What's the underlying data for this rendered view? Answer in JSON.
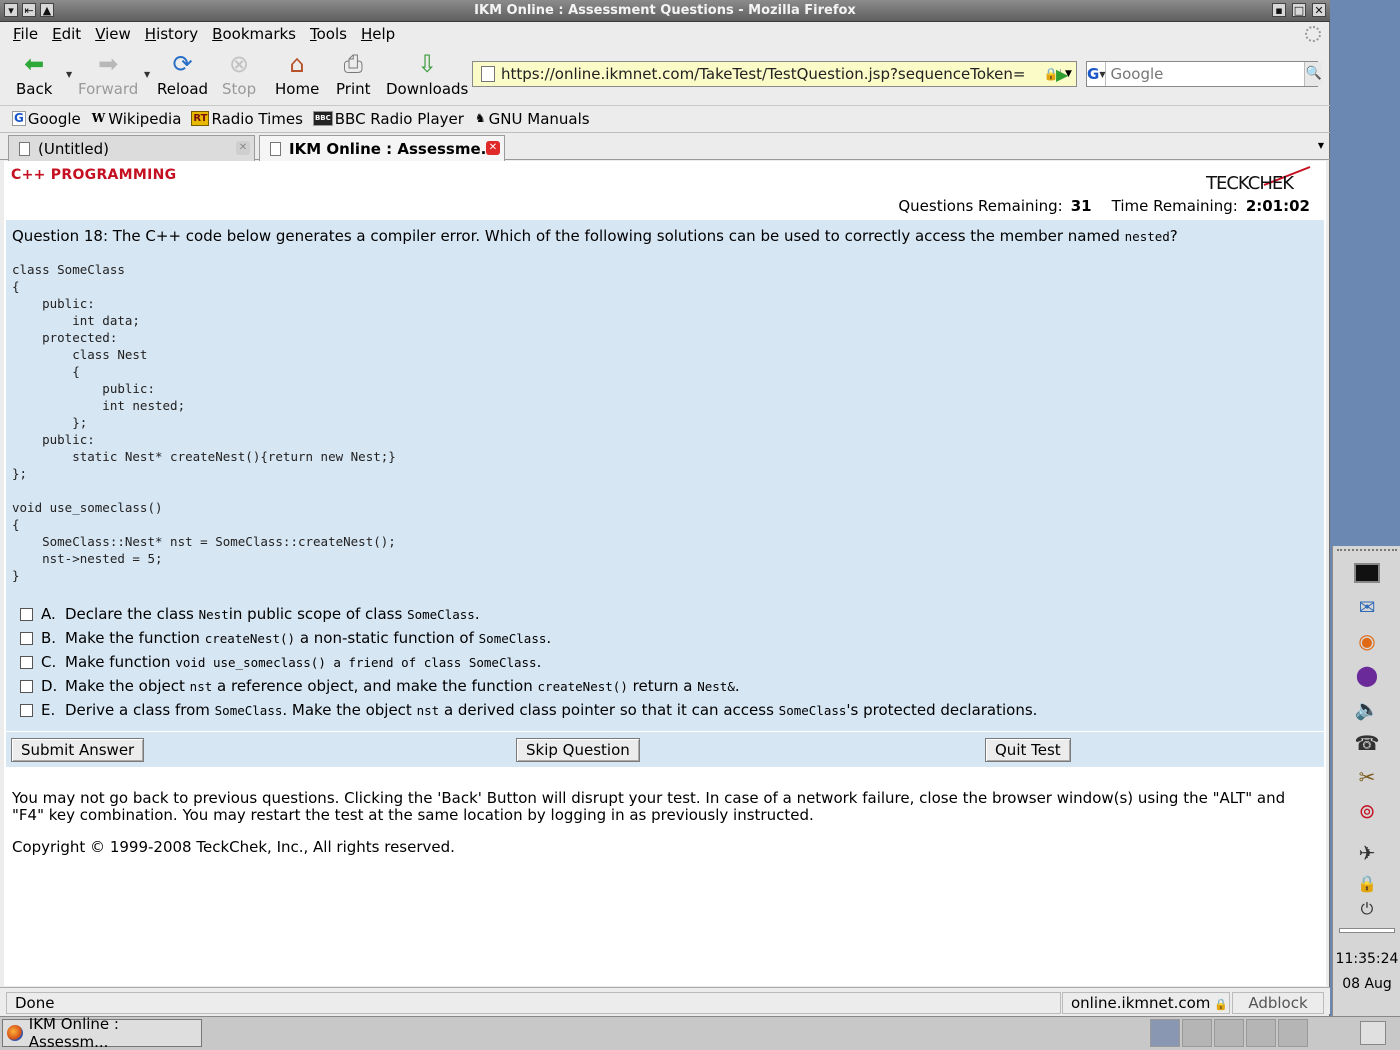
{
  "window": {
    "title": "IKM Online : Assessment Questions - Mozilla Firefox"
  },
  "menu": [
    "File",
    "Edit",
    "View",
    "History",
    "Bookmarks",
    "Tools",
    "Help"
  ],
  "nav": {
    "back": "Back",
    "forward": "Forward",
    "reload": "Reload",
    "stop": "Stop",
    "home": "Home",
    "print": "Print",
    "downloads": "Downloads"
  },
  "url": "https://online.ikmnet.com/TakeTest/TestQuestion.jsp?sequenceToken=",
  "search": {
    "placeholder": "Google",
    "engine_letter": "G"
  },
  "bookmarks": [
    "Google",
    "Wikipedia",
    "Radio Times",
    "BBC Radio Player",
    "GNU Manuals"
  ],
  "tabs": [
    "(Untitled)",
    "IKM Online : Assessme..."
  ],
  "page": {
    "section": "C++ PROGRAMMING",
    "logo": "TECKCHEK",
    "questions_label": "Questions Remaining:",
    "questions_value": "31",
    "time_label": "Time Remaining:",
    "time_value": "2:01:02",
    "question_prefix": "Question 18: The C++ code below generates a compiler error. Which of the following solutions can be used to correctly access the member named ",
    "question_code": "nested",
    "question_suffix": "?",
    "code": "class SomeClass\n{\n    public:\n        int data;\n    protected:\n        class Nest\n        {\n            public:\n            int nested;\n        };\n    public:\n        static Nest* createNest(){return new Nest;}\n};\n\nvoid use_someclass()\n{\n    SomeClass::Nest* nst = SomeClass::createNest();\n    nst->nested = 5;\n}",
    "options": {
      "a": {
        "key": "A.",
        "t1": "Declare the class ",
        "c1": "Nest",
        "t2": " in public scope of class ",
        "c2": "SomeClass",
        "t3": "."
      },
      "b": {
        "key": "B.",
        "t1": "Make the function ",
        "c1": "createNest()",
        "t2": " a non-static function of ",
        "c2": "SomeClass",
        "t3": "."
      },
      "c": {
        "key": "C.",
        "t1": "Make function ",
        "c1": "void use_someclass() a friend of class SomeClass",
        "t2": "."
      },
      "d": {
        "key": "D.",
        "t1": "Make the object ",
        "c1": "nst",
        "t2": " a reference object, and make the function ",
        "c2": "createNest()",
        "t3": " return a ",
        "c3": "Nest&",
        "t4": "."
      },
      "e": {
        "key": "E.",
        "t1": "Derive a class from ",
        "c1": "SomeClass",
        "t2": ". Make the object ",
        "c2": "nst",
        "t3": " a derived class pointer so that it can access ",
        "c3": "SomeClass",
        "t4": "'s protected declarations."
      }
    },
    "buttons": {
      "submit": "Submit Answer",
      "skip": "Skip Question",
      "quit": "Quit Test"
    },
    "note": "You may not go back to previous questions. Clicking the 'Back' Button will disrupt your test. In case of a network failure, close the browser window(s) using the \"ALT\" and \"F4\" key combination. You may restart the test at the same location by logging in as previously instructed.",
    "copyright": "Copyright © 1999-2008 TeckChek, Inc., All rights reserved."
  },
  "status": {
    "text": "Done",
    "host": "online.ikmnet.com",
    "adblock": "Adblock"
  },
  "taskbar": {
    "task": "IKM Online : Assessm..."
  },
  "clock": {
    "time": "11:35:24",
    "date": "08 Aug"
  },
  "colors": {
    "accent_red": "#c41020",
    "question_bg": "#d7e6f3",
    "url_bg": "#fbfbc8"
  }
}
